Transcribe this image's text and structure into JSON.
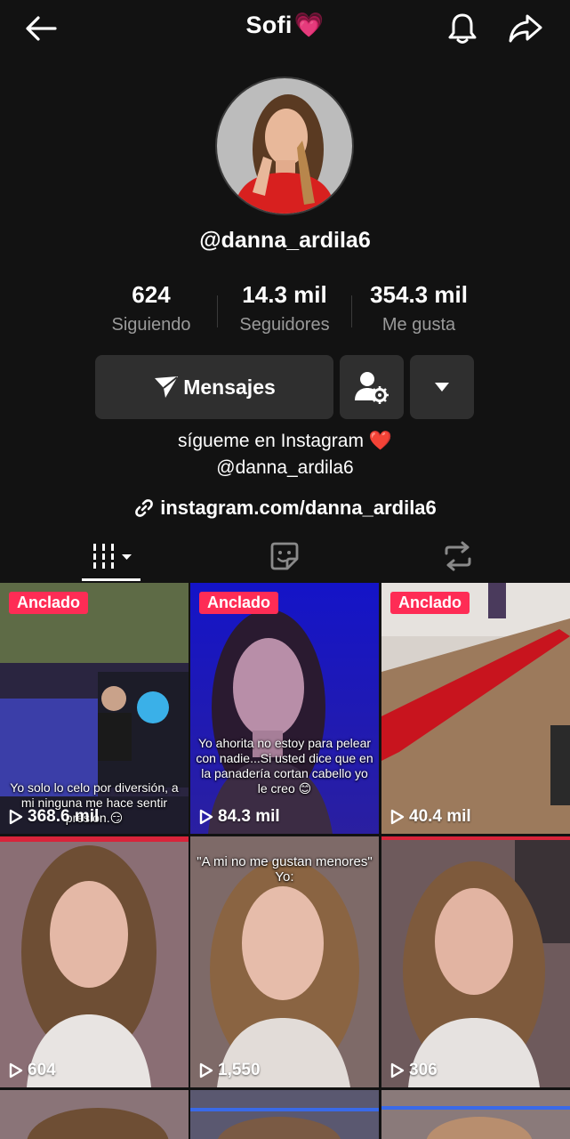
{
  "header": {
    "title": "Sofi",
    "title_emoji": "💗"
  },
  "profile": {
    "handle": "@danna_ardila6"
  },
  "stats": [
    {
      "value": "624",
      "label": "Siguiendo"
    },
    {
      "value": "14.3 mil",
      "label": "Seguidores"
    },
    {
      "value": "354.3 mil",
      "label": "Me gusta"
    }
  ],
  "actions": {
    "message_label": "Mensajes"
  },
  "bio": {
    "line1": "sígueme en Instagram",
    "line1_emoji": "❤️",
    "line2": "@danna_ardila6",
    "link": "instagram.com/danna_ardila6"
  },
  "videos": [
    {
      "pinned_label": "Anclado",
      "views": "368.6 mil",
      "caption": "Yo solo lo celo por diversión, a mi ninguna me hace sentir presión.😏"
    },
    {
      "pinned_label": "Anclado",
      "views": "84.3 mil",
      "caption": "Yo ahorita no estoy para pelear con nadie...Si usted dice que en la panadería cortan cabello yo le creo 😊"
    },
    {
      "pinned_label": "Anclado",
      "views": "40.4 mil",
      "caption": ""
    },
    {
      "pinned_label": "",
      "views": "604",
      "caption": ""
    },
    {
      "pinned_label": "",
      "views": "1,550",
      "caption": "\"A mi no me gustan menores\" Yo:"
    },
    {
      "pinned_label": "",
      "views": "306",
      "caption": ""
    }
  ],
  "colors": {
    "background": "#121212",
    "button_bg": "#2f2f2f",
    "pinned_badge": "#fe2c55",
    "secondary_text": "#9a9a9a"
  },
  "icons": [
    "back-arrow-icon",
    "bell-icon",
    "share-icon",
    "send-icon",
    "user-settings-icon",
    "dropdown-icon",
    "link-icon",
    "grid-icon",
    "favorites-icon",
    "repost-icon",
    "play-icon"
  ]
}
